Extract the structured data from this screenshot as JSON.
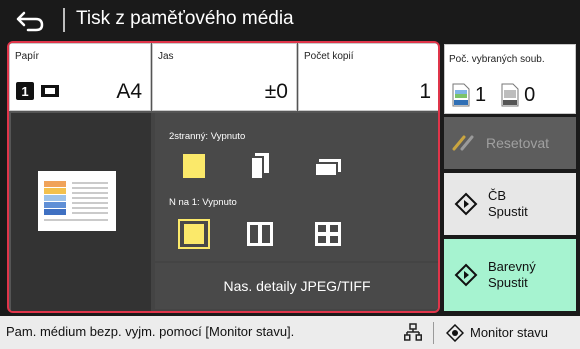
{
  "header": {
    "title": "Tisk z paměťového média"
  },
  "settings": {
    "paper": {
      "label": "Papír",
      "tray": "1",
      "size": "A4"
    },
    "brightness": {
      "label": "Jas",
      "value": "±0"
    },
    "copies": {
      "label": "Počet kopií",
      "value": "1"
    }
  },
  "options": {
    "duplex_label": "2stranný: Vypnuto",
    "nup_label": "N na 1: Vypnuto",
    "details_label": "Nas. detaily JPEG/TIFF"
  },
  "side": {
    "selected_files_label": "Poč. vybraných soub.",
    "jpeg_count": "1",
    "tiff_count": "0",
    "reset_label": "Resetovat",
    "bw_start": {
      "line1": "ČB",
      "line2": "Spustit"
    },
    "color_start": {
      "line1": "Barevný",
      "line2": "Spustit"
    }
  },
  "status": {
    "message": "Pam. médium bezp. vyjm. pomocí [Monitor stavu].",
    "monitor_label": "Monitor stavu"
  },
  "colors": {
    "highlight_border": "#e0354a",
    "color_start_bg": "#a6f3d0",
    "selected_yellow": "#fbe96a"
  }
}
